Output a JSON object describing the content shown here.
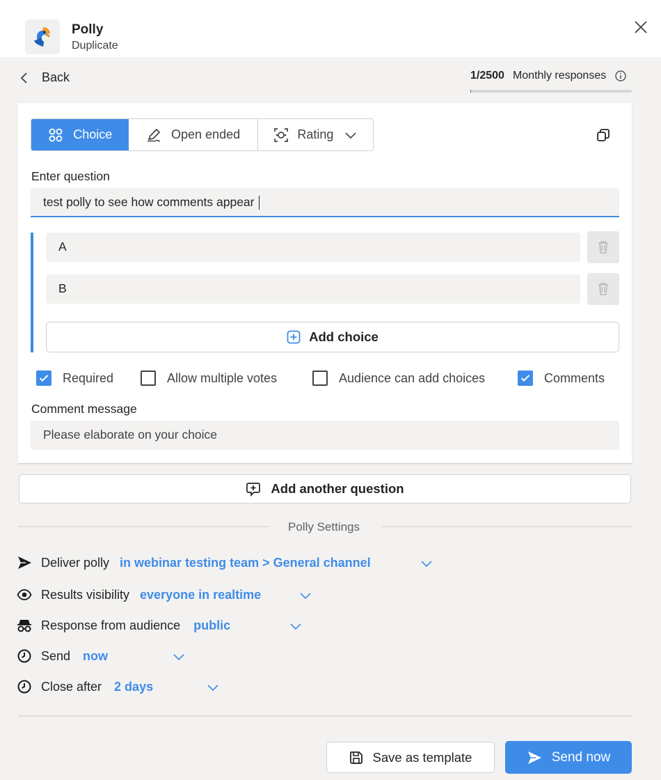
{
  "header": {
    "app_name": "Polly",
    "subtitle": "Duplicate",
    "close_icon": "close-icon"
  },
  "nav": {
    "back_label": "Back"
  },
  "usage": {
    "count": "1/2500",
    "label": "Monthly responses",
    "fraction": 0.0004
  },
  "question_types": [
    {
      "label": "Choice",
      "icon": "choice-icon",
      "active": true
    },
    {
      "label": "Open ended",
      "icon": "pen-icon",
      "active": false
    },
    {
      "label": "Rating",
      "icon": "rating-icon",
      "active": false
    }
  ],
  "question": {
    "label": "Enter question",
    "value": "test polly to see how comments appear"
  },
  "choices": [
    {
      "value": "A"
    },
    {
      "value": "B"
    }
  ],
  "add_choice_label": "Add choice",
  "options": [
    {
      "label": "Required",
      "checked": true
    },
    {
      "label": "Allow multiple votes",
      "checked": false
    },
    {
      "label": "Audience can add choices",
      "checked": false
    },
    {
      "label": "Comments",
      "checked": true
    }
  ],
  "comment": {
    "label": "Comment message",
    "value": "Please elaborate on your choice"
  },
  "add_question_label": "Add another question",
  "settings": {
    "title": "Polly Settings",
    "deliver": {
      "label": "Deliver polly",
      "value": "in webinar testing team > General channel"
    },
    "visibility": {
      "label": "Results visibility",
      "value": "everyone in realtime"
    },
    "audience": {
      "label": "Response from audience",
      "value": "public"
    },
    "send": {
      "label": "Send",
      "value": "now"
    },
    "close_after": {
      "label": "Close after",
      "value": "2 days"
    }
  },
  "footer": {
    "save_template_label": "Save as template",
    "send_now_label": "Send now"
  },
  "colors": {
    "accent": "#3f8ce8",
    "background": "#f3f2f1"
  }
}
